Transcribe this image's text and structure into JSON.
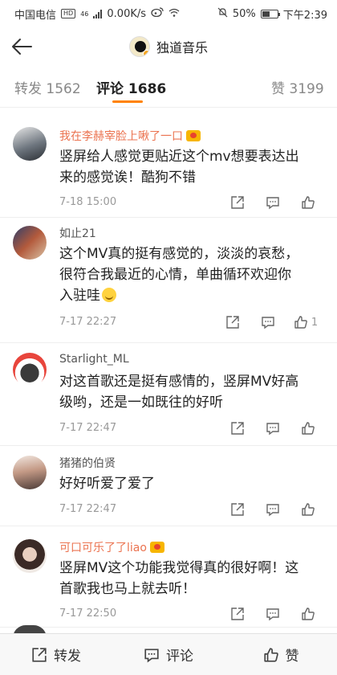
{
  "status": {
    "carrier": "中国电信",
    "hd": "HD",
    "network": "46",
    "speed": "0.00K/s",
    "battery": "50%",
    "time": "下午2:39"
  },
  "header": {
    "title": "独道音乐"
  },
  "tabs": [
    {
      "label": "转发 1562"
    },
    {
      "label": "评论 1686"
    },
    {
      "label": "赞 3199"
    }
  ],
  "comments": [
    {
      "name": "我在李赫宰脸上啾了一口",
      "vip": true,
      "text_lines": [
        "竖屏给人感觉更贴近这个mv想要表达出",
        "来的感觉诶！酷狗不错"
      ],
      "time": "7-18 15:00",
      "likes": ""
    },
    {
      "name": "如止21",
      "vip": false,
      "text_lines": [
        "这个MV真的挺有感觉的，淡淡的哀愁，",
        "很符合我最近的心情，单曲循环欢迎你",
        "入驻哇"
      ],
      "time": "7-17 22:27",
      "likes": "1"
    },
    {
      "name": "Starlight_ML",
      "vip": false,
      "text_lines": [
        "对这首歌还是挺有感情的，竖屏MV好高",
        "级哟，还是一如既往的好听"
      ],
      "time": "7-17 22:47",
      "likes": ""
    },
    {
      "name": "猪猪的伯贤",
      "vip": false,
      "text_lines": [
        "好好听爱了爱了"
      ],
      "time": "7-17 22:47",
      "likes": ""
    },
    {
      "name": "可口可乐了了liao",
      "vip": true,
      "text_lines": [
        "竖屏MV这个功能我觉得真的很好啊！这",
        "首歌我也马上就去听！"
      ],
      "time": "7-17 22:50",
      "likes": ""
    }
  ],
  "bottom": {
    "repost": "转发",
    "comment": "评论",
    "like": "赞"
  },
  "colors": {
    "accent": "#ff8200",
    "vip_name": "#eb7350"
  }
}
